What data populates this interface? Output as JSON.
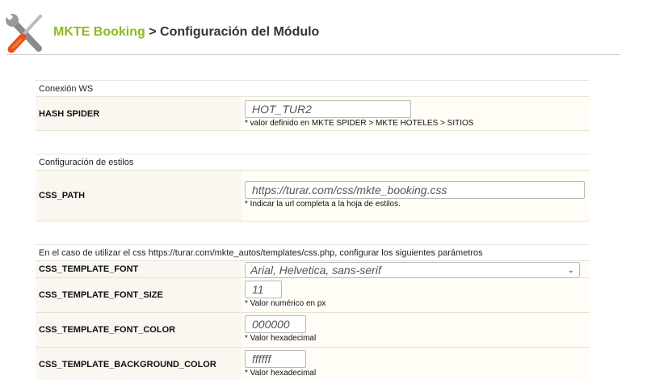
{
  "header": {
    "brand": "MKTE Booking",
    "separator": ">",
    "page_title": "Configuración del Módulo",
    "icon": "tools-icon"
  },
  "sections": [
    {
      "heading": "Conexión WS",
      "rows": [
        {
          "label": "HASH SPIDER",
          "value": "HOT_TUR2",
          "note": "* valor definido en MKTE SPIDER > MKTE HOTELES > SITIOS"
        }
      ]
    },
    {
      "heading": "Configuración de estilos",
      "rows": [
        {
          "label": "CSS_PATH",
          "value": "https://turar.com/css/mkte_booking.css",
          "note": "* Indicar la url completa a la hoja de estilos."
        }
      ]
    },
    {
      "heading": "En el caso de utilizar el css https://turar.com/mkte_autos/templates/css.php, configurar los siguientes parámetros",
      "rows": [
        {
          "label": "CSS_TEMPLATE_FONT",
          "value": "Arial, Helvetica, sans-serif",
          "note": ""
        },
        {
          "label": "CSS_TEMPLATE_FONT_SIZE",
          "value": "11",
          "note": "* Valor numérico en px"
        },
        {
          "label": "CSS_TEMPLATE_FONT_COLOR",
          "value": "000000",
          "note": "* Valor hexadecimal"
        },
        {
          "label": "CSS_TEMPLATE_BACKGROUND_COLOR",
          "value": "ffffff",
          "note": "* Valor hexadecimal"
        }
      ]
    }
  ],
  "colors": {
    "brand": "#8dbb1c",
    "label_bg": "#faf7f1",
    "value_bg": "#fffdf6"
  }
}
